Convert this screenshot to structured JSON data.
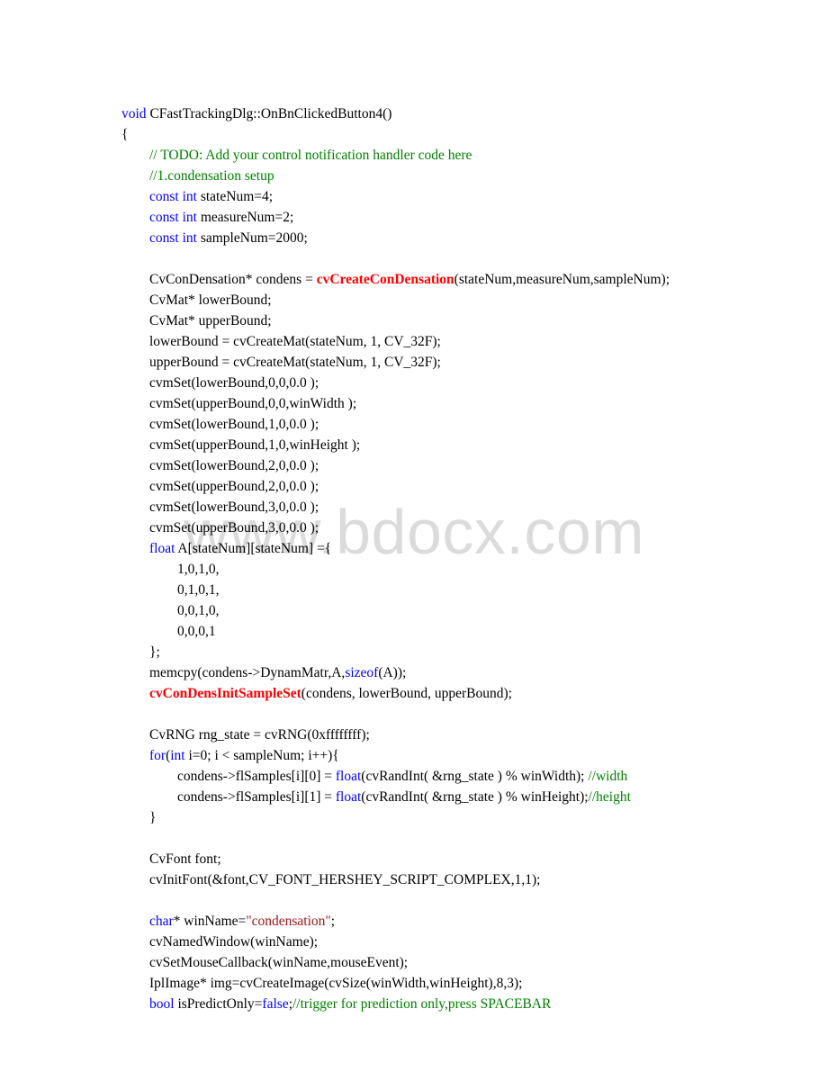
{
  "watermark": "www.bdocx.com",
  "code": {
    "l01_a": "void",
    "l01_b": " CFastTrackingDlg::OnBnClickedButton4()",
    "l02": "{",
    "l03": "        // TODO: Add your control notification handler code here",
    "l04": "        //1.condensation setup",
    "l05_a": "        const int",
    "l05_b": " stateNum=4;",
    "l06_a": "        const int",
    "l06_b": " measureNum=2;",
    "l07_a": "        const int",
    "l07_b": " sampleNum=2000;",
    "blank_a": "",
    "l08_a": "        CvConDensation* condens = ",
    "l08_b": "cvCreateConDensation",
    "l08_c": "(stateNum,measureNum,sampleNum);",
    "l09": "        CvMat* lowerBound;",
    "l10": "        CvMat* upperBound;",
    "l11": "        lowerBound = cvCreateMat(stateNum, 1, CV_32F);",
    "l12": "        upperBound = cvCreateMat(stateNum, 1, CV_32F);",
    "l13": "        cvmSet(lowerBound,0,0,0.0 );",
    "l14": "        cvmSet(upperBound,0,0,winWidth );",
    "l15": "        cvmSet(lowerBound,1,0,0.0 );",
    "l16": "        cvmSet(upperBound,1,0,winHeight );",
    "l17": "        cvmSet(lowerBound,2,0,0.0 );",
    "l18": "        cvmSet(upperBound,2,0,0.0 );",
    "l19": "        cvmSet(lowerBound,3,0,0.0 );",
    "l20": "        cvmSet(upperBound,3,0,0.0 );",
    "l21_a": "        float",
    "l21_b": " A[stateNum][stateNum] ={",
    "l22": "                1,0,1,0,",
    "l23": "                0,1,0,1,",
    "l24": "                0,0,1,0,",
    "l25": "                0,0,0,1",
    "l26": "        };",
    "l27_a": "        memcpy(condens->DynamMatr,A,",
    "l27_b": "sizeof",
    "l27_c": "(A));",
    "l28_a": "        ",
    "l28_b": "cvConDensInitSampleSet",
    "l28_c": "(condens, lowerBound, upperBound);",
    "blank_b": "",
    "l29": "        CvRNG rng_state = cvRNG(0xffffffff);",
    "l30_a": "        for",
    "l30_b": "(",
    "l30_c": "int",
    "l30_d": " i=0; i < sampleNum; i++){",
    "l31_a": "                condens->flSamples[i][0] = ",
    "l31_b": "float",
    "l31_c": "(cvRandInt( &rng_state ) % winWidth); ",
    "l31_d": "//width",
    "l32_a": "                condens->flSamples[i][1] = ",
    "l32_b": "float",
    "l32_c": "(cvRandInt( &rng_state ) % winHeight);",
    "l32_d": "//height",
    "l33": "        }",
    "blank_c": "",
    "l34": "        CvFont font;",
    "l35": "        cvInitFont(&font,CV_FONT_HERSHEY_SCRIPT_COMPLEX,1,1);",
    "blank_d": "",
    "l36_a": "        char",
    "l36_b": "* winName=",
    "l36_c": "\"condensation\"",
    "l36_d": ";",
    "l37": "        cvNamedWindow(winName);",
    "l38": "        cvSetMouseCallback(winName,mouseEvent);",
    "l39": "        IplImage* img=cvCreateImage(cvSize(winWidth,winHeight),8,3);",
    "l40_a": "        bool",
    "l40_b": " isPredictOnly=",
    "l40_c": "false",
    "l40_d": ";",
    "l40_e": "//trigger for prediction only,press SPACEBAR"
  }
}
